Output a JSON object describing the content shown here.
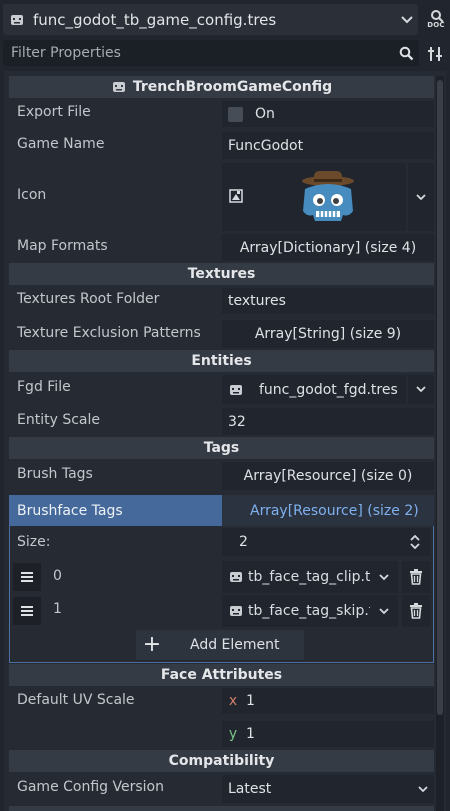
{
  "header": {
    "resource_name": "func_godot_tb_game_config.tres",
    "doc_label": "DOC"
  },
  "filter": {
    "placeholder": "Filter Properties"
  },
  "class_header": "TrenchBroomGameConfig",
  "props": {
    "export_file": {
      "label": "Export File",
      "value": "On",
      "checked": false
    },
    "game_name": {
      "label": "Game Name",
      "value": "FuncGodot"
    },
    "icon": {
      "label": "Icon"
    },
    "map_formats": {
      "label": "Map Formats",
      "value": "Array[Dictionary] (size 4)"
    }
  },
  "textures": {
    "section": "Textures",
    "root_folder": {
      "label": "Textures Root Folder",
      "value": "textures"
    },
    "exclusion": {
      "label": "Texture Exclusion Patterns",
      "value": "Array[String] (size 9)"
    }
  },
  "entities": {
    "section": "Entities",
    "fgd_file": {
      "label": "Fgd File",
      "value": "func_godot_fgd.tres"
    },
    "entity_scale": {
      "label": "Entity Scale",
      "value": "32"
    }
  },
  "tags": {
    "section": "Tags",
    "brush_tags": {
      "label": "Brush Tags",
      "value": "Array[Resource] (size 0)"
    },
    "brushface_tags": {
      "label": "Brushface Tags",
      "value": "Array[Resource] (size 2)"
    },
    "size_label": "Size:",
    "size_value": "2",
    "elements": [
      {
        "index": "0",
        "value": "tb_face_tag_clip.tr"
      },
      {
        "index": "1",
        "value": "tb_face_tag_skip.t"
      }
    ],
    "add_element": "Add Element"
  },
  "face_attributes": {
    "section": "Face Attributes",
    "default_uv": {
      "label": "Default UV Scale",
      "x_axis": "x",
      "x": "1",
      "y_axis": "y",
      "y": "1"
    }
  },
  "compatibility": {
    "section": "Compatibility",
    "version": {
      "label": "Game Config Version",
      "value": "Latest"
    }
  },
  "colors": {
    "accent": "#45699a",
    "link": "#7fb1ee",
    "x_axis": "#d27e6a",
    "y_axis": "#79c48a"
  }
}
